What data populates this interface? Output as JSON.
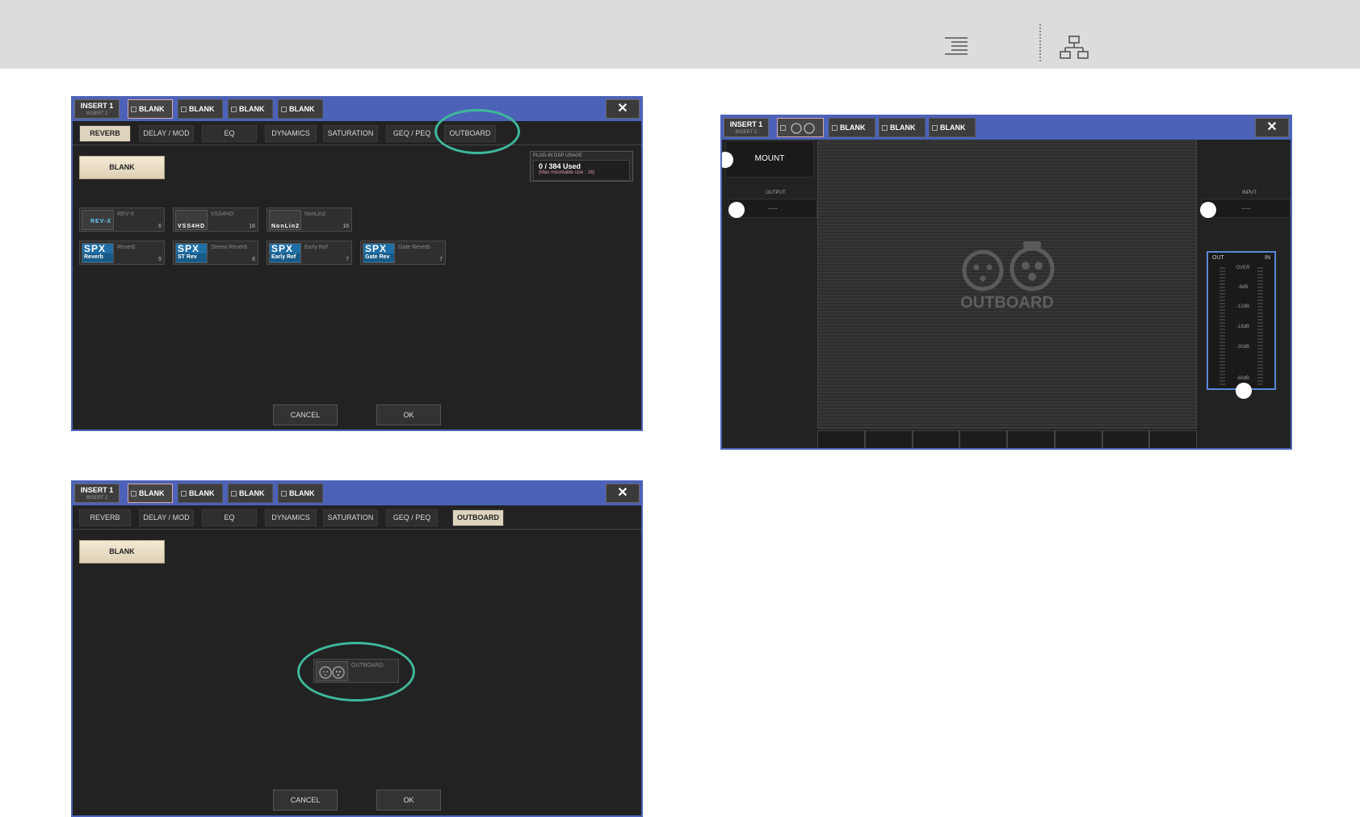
{
  "panel_top": {
    "insert_label": "INSERT 1",
    "insert_sub": "INSERT 2",
    "slots": [
      "BLANK",
      "BLANK",
      "BLANK",
      "BLANK"
    ],
    "close": "✕",
    "tabs": [
      "REVERB",
      "DELAY / MOD",
      "EQ",
      "DYNAMICS",
      "SATURATION",
      "GEQ / PEQ",
      "OUTBOARD"
    ],
    "blank_label": "BLANK",
    "dsp_title": "PLUG-IN DSP USAGE",
    "dsp_used": "0 / 384 Used",
    "dsp_max": "(Max mountable size : 16)",
    "plugins": [
      {
        "thumb": "REV-X",
        "name": "REV-X",
        "count": "6"
      },
      {
        "thumb": "VSS4HD",
        "name": "VSS4HD",
        "count": "16"
      },
      {
        "thumb": "NonLin2",
        "name": "NonLin2",
        "count": "16"
      },
      {
        "thumb_big": "SPX",
        "thumb_sm": "Reverb",
        "name": "Reverb",
        "count": "5"
      },
      {
        "thumb_big": "SPX",
        "thumb_sm": "ST Rev",
        "name": "Stereo Reverb",
        "count": "6"
      },
      {
        "thumb_big": "SPX",
        "thumb_sm": "Early Ref",
        "name": "Early Ref.",
        "count": "7"
      },
      {
        "thumb_big": "SPX",
        "thumb_sm": "Gate Rev",
        "name": "Gate Reverb",
        "count": "7"
      }
    ],
    "cancel": "CANCEL",
    "ok": "OK"
  },
  "panel_bottom": {
    "insert_label": "INSERT 1",
    "insert_sub": "INSERT 2",
    "slots": [
      "BLANK",
      "BLANK",
      "BLANK",
      "BLANK"
    ],
    "close": "✕",
    "tabs": [
      "REVERB",
      "DELAY / MOD",
      "EQ",
      "DYNAMICS",
      "SATURATION",
      "GEQ / PEQ",
      "OUTBOARD"
    ],
    "blank_label": "BLANK",
    "outboard_plugin": "OUTBOARD",
    "cancel": "CANCEL",
    "ok": "OK"
  },
  "panel_right": {
    "insert_label": "INSERT 1",
    "insert_sub": "INSERT 2",
    "slots": [
      "BLANK",
      "BLANK",
      "BLANK"
    ],
    "close": "✕",
    "mount": "MOUNT",
    "output_label": "OUTPUT",
    "output_value": "----",
    "input_label": "INPUT",
    "input_value": "----",
    "center_label": "OUTBOARD",
    "meter": {
      "out": "OUT",
      "in": "IN",
      "scale": [
        "OVER",
        "-6dB",
        "-12dB",
        "-18dB",
        "-30dB",
        "-60dB"
      ]
    }
  },
  "colors": {
    "header_blue": "#4b62b8",
    "panel_bg": "#222222",
    "highlight": "#3fb89b",
    "active_tab": "#ded3bd"
  }
}
